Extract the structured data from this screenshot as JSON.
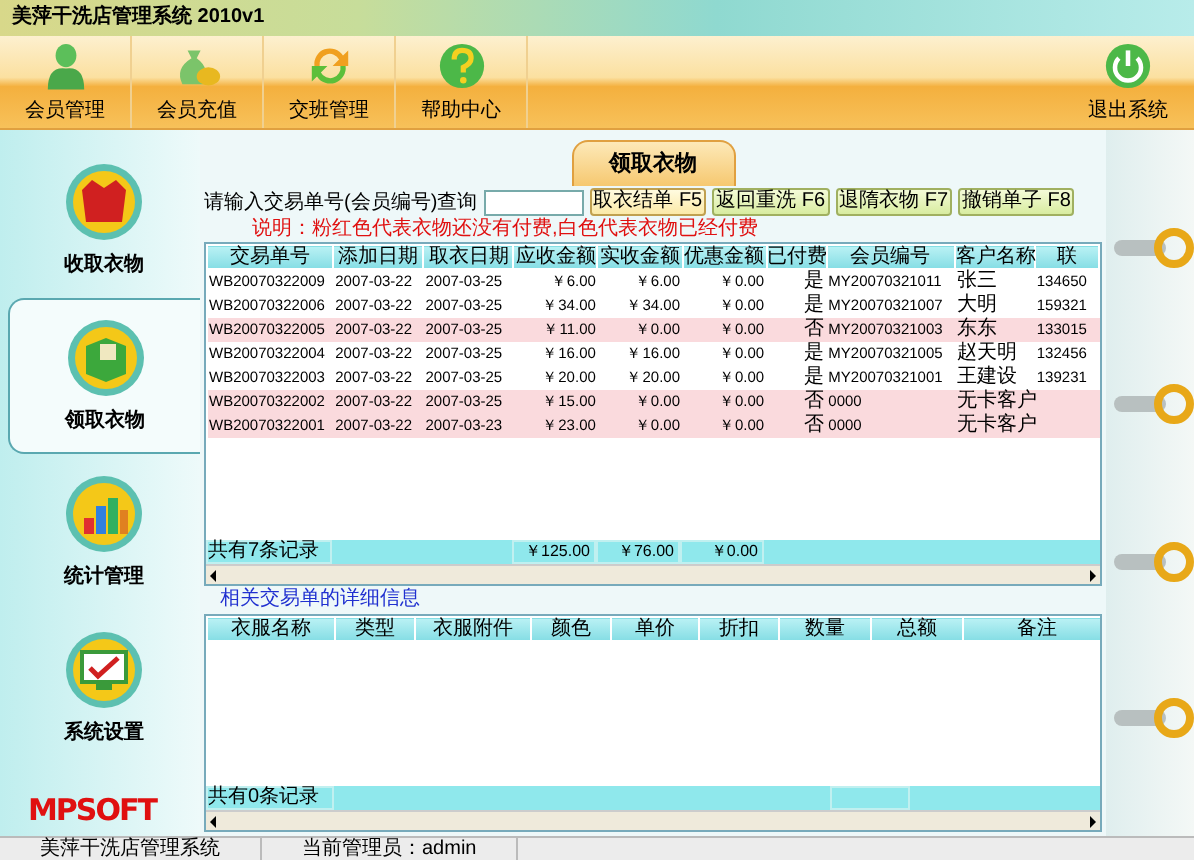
{
  "window": {
    "title": "美萍干洗店管理系统 2010v1"
  },
  "toolbar": {
    "buttons": [
      {
        "label": "会员管理"
      },
      {
        "label": "会员充值"
      },
      {
        "label": "交班管理"
      },
      {
        "label": "帮助中心"
      }
    ],
    "exit": {
      "label": "退出系统"
    }
  },
  "sidebar": {
    "items": [
      {
        "label": "收取衣物",
        "selected": false
      },
      {
        "label": "领取衣物",
        "selected": true
      },
      {
        "label": "统计管理",
        "selected": false
      },
      {
        "label": "系统设置",
        "selected": false
      }
    ],
    "logo": "MPSOFT"
  },
  "page_title": "领取衣物",
  "search": {
    "label": "请输入交易单号(会员编号)查询"
  },
  "action_buttons": [
    {
      "label": "取衣结单 F5",
      "focused": true
    },
    {
      "label": "返回重洗 F6",
      "focused": false
    },
    {
      "label": "退隋衣物 F7",
      "focused": false
    },
    {
      "label": "撤销单子 F8",
      "focused": false
    }
  ],
  "note": "说明：粉红色代表衣物还没有付费,白色代表衣物已经付费",
  "orders_table": {
    "columns": [
      "交易单号",
      "添加日期",
      "取衣日期",
      "应收金额",
      "实收金额",
      "优惠金额",
      "已付费",
      "会员编号",
      "客户名称",
      "联"
    ],
    "rows": [
      {
        "paid": true,
        "cells": [
          "WB20070322009",
          "2007-03-22",
          "2007-03-25",
          "￥6.00",
          "￥6.00",
          "￥0.00",
          "是",
          "MY20070321011",
          "张三",
          "134650"
        ]
      },
      {
        "paid": true,
        "cells": [
          "WB20070322006",
          "2007-03-22",
          "2007-03-25",
          "￥34.00",
          "￥34.00",
          "￥0.00",
          "是",
          "MY20070321007",
          "大明",
          "159321"
        ]
      },
      {
        "paid": false,
        "cells": [
          "WB20070322005",
          "2007-03-22",
          "2007-03-25",
          "￥11.00",
          "￥0.00",
          "￥0.00",
          "否",
          "MY20070321003",
          "东东",
          "133015"
        ]
      },
      {
        "paid": true,
        "cells": [
          "WB20070322004",
          "2007-03-22",
          "2007-03-25",
          "￥16.00",
          "￥16.00",
          "￥0.00",
          "是",
          "MY20070321005",
          "赵天明",
          "132456"
        ]
      },
      {
        "paid": true,
        "cells": [
          "WB20070322003",
          "2007-03-22",
          "2007-03-25",
          "￥20.00",
          "￥20.00",
          "￥0.00",
          "是",
          "MY20070321001",
          "王建设",
          "139231"
        ]
      },
      {
        "paid": false,
        "cells": [
          "WB20070322002",
          "2007-03-22",
          "2007-03-25",
          "￥15.00",
          "￥0.00",
          "￥0.00",
          "否",
          "0000",
          "无卡客户",
          ""
        ]
      },
      {
        "paid": false,
        "cells": [
          "WB20070322001",
          "2007-03-22",
          "2007-03-23",
          "￥23.00",
          "￥0.00",
          "￥0.00",
          "否",
          "0000",
          "无卡客户",
          ""
        ]
      }
    ],
    "footer": {
      "count": "共有7条记录",
      "totals": [
        "￥125.00",
        "￥76.00",
        "￥0.00"
      ]
    }
  },
  "details": {
    "title": "相关交易单的详细信息",
    "columns": [
      "衣服名称",
      "类型",
      "衣服附件",
      "颜色",
      "单价",
      "折扣",
      "数量",
      "总额",
      "备注"
    ],
    "footer": {
      "count": "共有0条记录"
    }
  },
  "status_bar": {
    "items": [
      "美萍干洗店管理系统",
      "当前管理员：admin"
    ]
  }
}
